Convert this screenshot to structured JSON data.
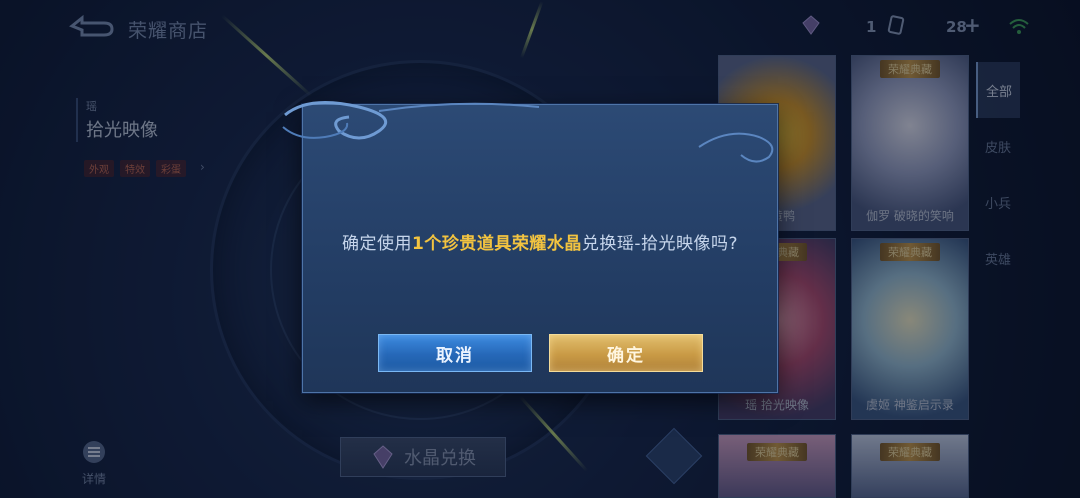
{
  "header": {
    "title": "荣耀商店",
    "resources": {
      "first_count": "1",
      "second_count": "28"
    }
  },
  "hero": {
    "hero_name": "瑶",
    "skin_name": "拾光映像",
    "tags": [
      "外观",
      "特效",
      "彩蛋"
    ]
  },
  "bottom": {
    "detail_label": "详情",
    "exchange_label": "水晶兑换"
  },
  "cards": [
    {
      "label": "小黄鸭",
      "banner": ""
    },
    {
      "label": "伽罗 破晓的笑响",
      "banner": "荣耀典藏"
    },
    {
      "label": "瑶 拾光映像",
      "banner": "荣耀典藏"
    },
    {
      "label": "虞姬 神鉴启示录",
      "banner": "荣耀典藏"
    },
    {
      "label": "",
      "banner": "荣耀典藏"
    },
    {
      "label": "",
      "banner": "荣耀典藏"
    }
  ],
  "right_tabs": [
    "全部",
    "皮肤",
    "小兵",
    "英雄"
  ],
  "dialog": {
    "msg_prefix": "确定使用",
    "msg_highlight": "1个珍贵道具荣耀水晶",
    "msg_suffix": "兑换瑶-拾光映像吗?",
    "cancel_label": "取消",
    "confirm_label": "确定"
  },
  "colors": {
    "highlight": "#f2c340",
    "cancel_button": "#2668b8",
    "confirm_button": "#c99a45"
  }
}
